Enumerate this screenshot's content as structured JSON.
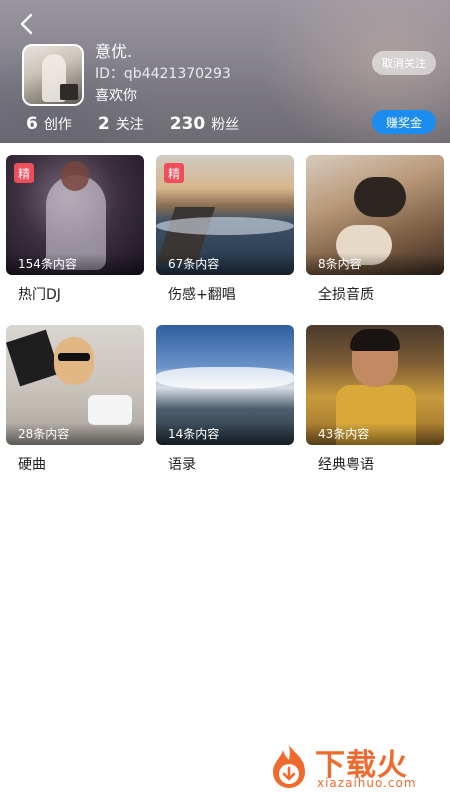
{
  "header": {
    "user_name": "意优.",
    "user_id_label": "ID：",
    "user_id_value": "qb4421370293",
    "like_text": "喜欢你",
    "unfollow_label": "取消关注",
    "reward_label": "赚奖金",
    "stats": [
      {
        "num": "6",
        "label": "创作"
      },
      {
        "num": "2",
        "label": "关注"
      },
      {
        "num": "230",
        "label": "粉丝"
      }
    ]
  },
  "collections": [
    {
      "title": "热门DJ",
      "count": "154条内容",
      "badge": "精"
    },
    {
      "title": "伤感+翻唱",
      "count": "67条内容",
      "badge": "精"
    },
    {
      "title": "全损音质",
      "count": "8条内容",
      "badge": ""
    },
    {
      "title": "硬曲",
      "count": "28条内容",
      "badge": ""
    },
    {
      "title": "语录",
      "count": "14条内容",
      "badge": ""
    },
    {
      "title": "经典粤语",
      "count": "43条内容",
      "badge": ""
    }
  ],
  "watermark": {
    "main": "下载火",
    "sub": "xiazaihuo.com"
  },
  "icons": {
    "back": "back-arrow-icon"
  },
  "colors": {
    "accent": "#1b8cf0",
    "badge": "#f04d5a",
    "watermark": "#ef6a2c"
  }
}
